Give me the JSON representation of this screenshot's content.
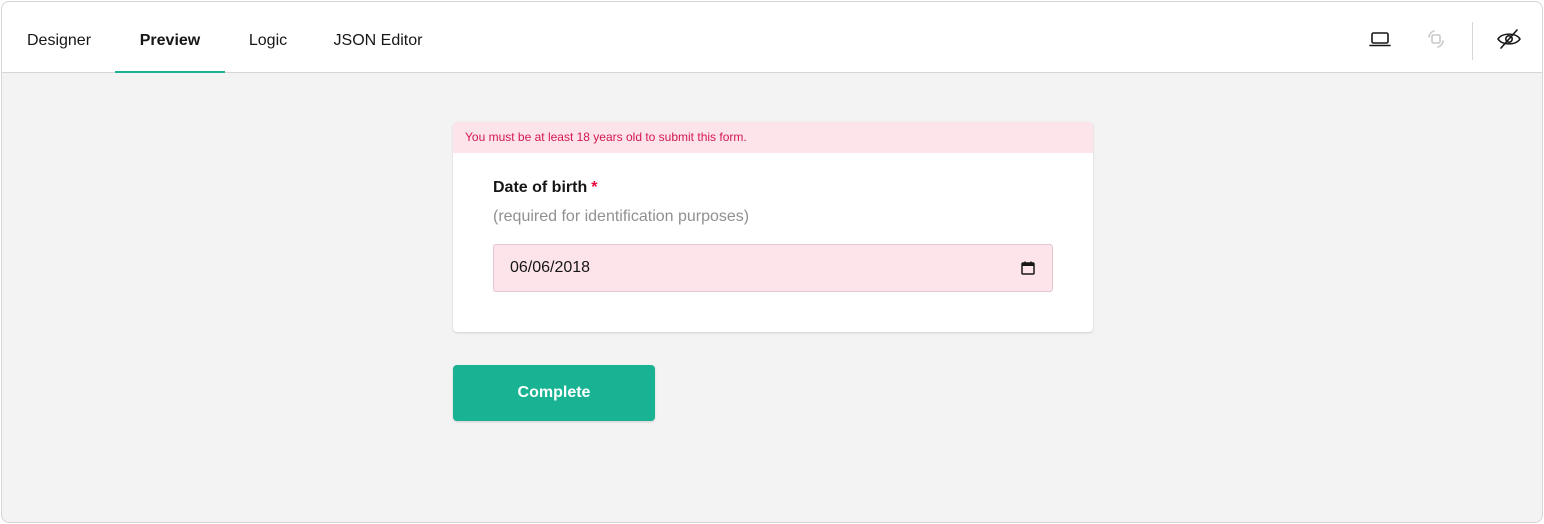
{
  "tabs": [
    {
      "label": "Designer",
      "active": false
    },
    {
      "label": "Preview",
      "active": true
    },
    {
      "label": "Logic",
      "active": false
    },
    {
      "label": "JSON Editor",
      "active": false
    }
  ],
  "toolbar": {
    "icons": [
      "device-laptop-icon",
      "orientation-icon",
      "hide-invisible-icon"
    ]
  },
  "survey": {
    "error_message": "You must be at least 18 years old to submit this form.",
    "question": {
      "title": "Date of birth",
      "required_marker": "*",
      "description": "(required for identification purposes)",
      "value": "06/06/2018"
    },
    "complete_label": "Complete"
  },
  "colors": {
    "accent": "#19b394",
    "error_text": "#d4174f",
    "error_bg": "#fce4ea",
    "background": "#f3f3f3"
  }
}
